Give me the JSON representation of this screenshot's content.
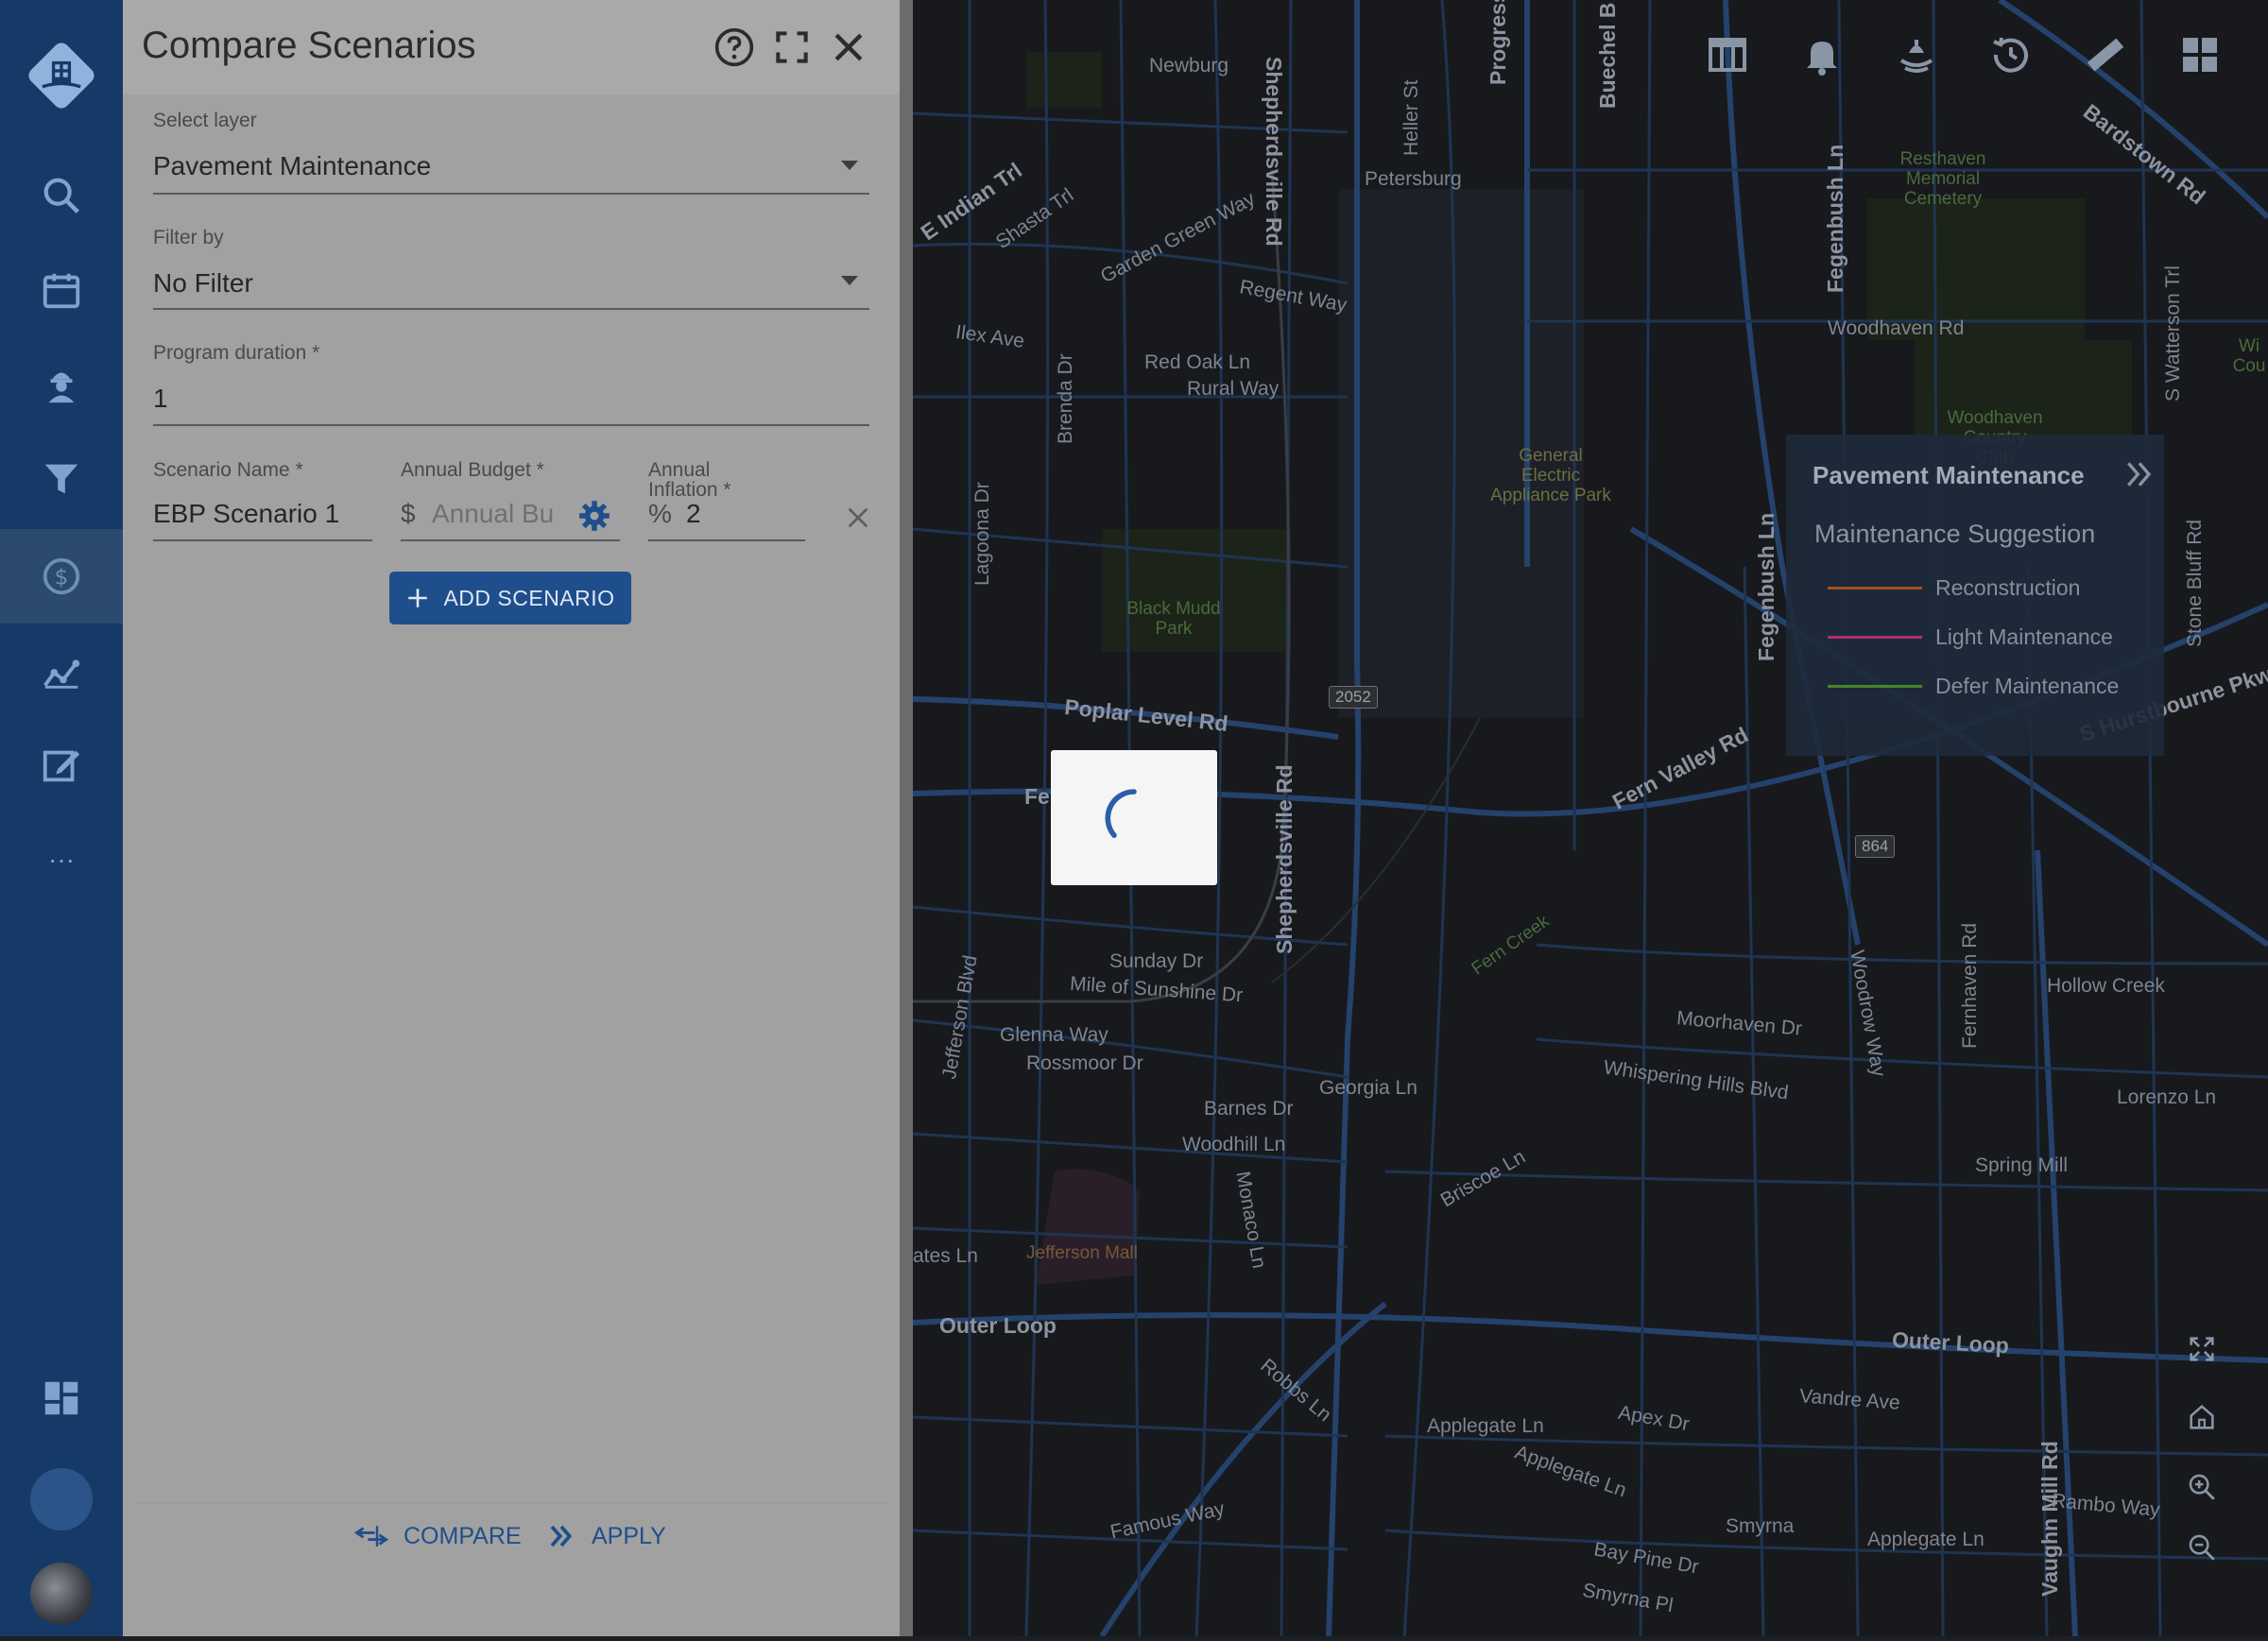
{
  "nav": {
    "items": [
      "logo-icon",
      "search-icon",
      "calendar-icon",
      "worker-icon",
      "filter-icon",
      "dollar-icon",
      "analytics-icon",
      "edit-icon",
      "more-icon",
      "dashboard-icon",
      "circle-icon",
      "avatar"
    ],
    "more_label": "···"
  },
  "panel": {
    "title": "Compare Scenarios",
    "select_layer": {
      "label": "Select layer",
      "value": "Pavement Maintenance"
    },
    "filter_by": {
      "label": "Filter by",
      "value": "No Filter"
    },
    "program_duration": {
      "label": "Program duration *",
      "value": "1"
    },
    "scenario": {
      "name_label": "Scenario Name *",
      "name_value": "EBP Scenario 1",
      "budget_label": "Annual Budget *",
      "budget_prefix": "$",
      "budget_placeholder": "Annual Bu",
      "inflation_label_1": "Annual",
      "inflation_label_2": "Inflation *",
      "inflation_prefix": "%",
      "inflation_value": "2"
    },
    "add_scenario_label": "ADD SCENARIO",
    "compare_label": "COMPARE",
    "apply_label": "APPLY"
  },
  "map": {
    "labels": {
      "newburg": "Newburg",
      "petersburg": "Petersburg",
      "regent": "Regent Way",
      "redoak": "Red Oak Ln",
      "rural": "Rural Way",
      "ilex": "Ilex Ave",
      "poplar": "Poplar Level Rd",
      "fernvalley": "Fern Valley Rd",
      "woodhaven": "Woodhaven Rd",
      "sunday": "Sunday Dr",
      "mileof": "Mile of Sunshine Dr",
      "glenna": "Glenna Way",
      "rossmoor": "Rossmoor Dr",
      "georgia": "Georgia Ln",
      "barnes": "Barnes Dr",
      "woodhill": "Woodhill Ln",
      "moorhaven": "Moorhaven Dr",
      "whispering": "Whispering Hills Blvd",
      "hollow": "Hollow Creek",
      "lorenzo": "Lorenzo Ln",
      "spring": "Spring Mill",
      "outer1": "Outer Loop",
      "outer2": "Outer Loop",
      "vandre": "Vandre Ave",
      "applegate1": "Applegate Ln",
      "apex": "Apex Dr",
      "applegate2": "Applegate Ln",
      "applegate3": "Applegate Ln",
      "smyrna": "Smyrna",
      "baypine": "Bay Pine Dr",
      "smyrnapl": "Smyrna Pl",
      "famous": "Famous Way",
      "rambo": "Rambo Way",
      "hurstbourne": "S Hurstbourne Pkwy",
      "bardstown": "Bardstown Rd",
      "fe": "Fe",
      "gardengreen": "Garden Green Way",
      "shasta": "Shasta Trl",
      "indian": "E Indian Trl",
      "briscoe": "Briscoe Ln",
      "robbs": "Robbs Ln",
      "ates": "ates Ln"
    },
    "vertical_labels": {
      "shepherdsville1": "Shepherdsville Rd",
      "shepherdsville2": "Shepherdsville Rd",
      "fegenbush1": "Fegenbush Ln",
      "fegenbush2": "Fegenbush Ln",
      "brenda": "Brenda Dr",
      "laguna": "Lagoona Dr",
      "jefferson": "Jefferson Blvd",
      "monaco": "Monaco Ln",
      "woodrow": "Woodrow Way",
      "fernhaven": "Fernhaven Rd",
      "vaughn": "Vaughn Mill Rd",
      "stonebluff": "Stone Bluff Rd",
      "watterson": "S Watterson Trl",
      "buechel": "Buechel B",
      "progress": "Progress",
      "heller": "Heller St"
    },
    "places": {
      "resthaven": "Resthaven Memorial Cemetery",
      "woodhaven_cc": "Woodhaven Country Club",
      "ge": "General Electric Appliance Park",
      "blackmudd": "Black Mudd Park",
      "jeffmall": "Jefferson Mall",
      "ferncreek": "Fern Creek",
      "wicou": "Wi Cou"
    },
    "shields": {
      "s2052": "2052",
      "s864": "864"
    },
    "toolbar": [
      "table-icon",
      "bell-icon",
      "weather-icon",
      "history-icon",
      "ruler-icon",
      "grid-icon"
    ],
    "legend": {
      "title": "Pavement Maintenance",
      "subtitle": "Maintenance Suggestion",
      "items": [
        {
          "label": "Reconstruction",
          "color": "#b5541c"
        },
        {
          "label": "Light Maintenance",
          "color": "#c0317f"
        },
        {
          "label": "Defer Maintenance",
          "color": "#4f8f2a"
        }
      ]
    }
  }
}
